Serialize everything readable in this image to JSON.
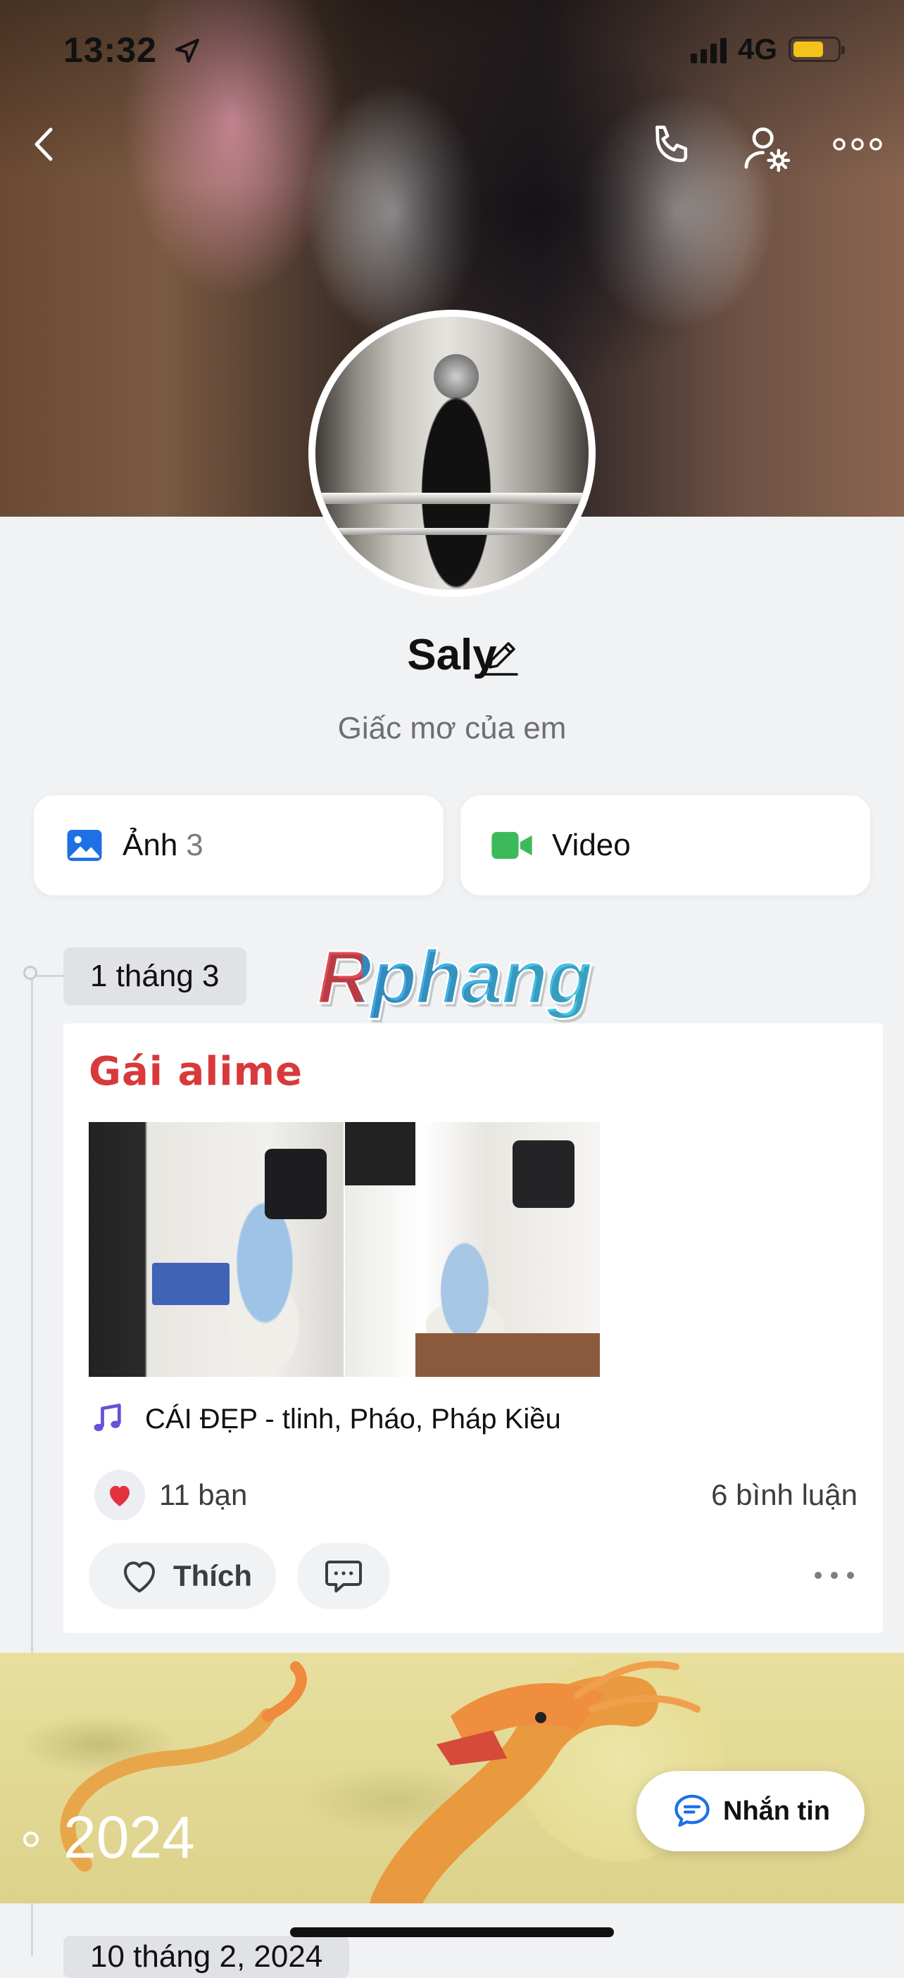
{
  "status_bar": {
    "time": "13:32",
    "network": "4G",
    "colors": {
      "battery": "#f4c21b"
    }
  },
  "header": {
    "icons": [
      "back-icon",
      "phone-icon",
      "profile-settings-icon",
      "more-icon"
    ]
  },
  "profile": {
    "name": "Saly",
    "bio": "Giấc mơ của em"
  },
  "media": {
    "photos_label": "Ảnh",
    "photos_count": "3",
    "video_label": "Video",
    "colors": {
      "photos_icon": "#1f6fe5",
      "video_icon": "#3cba5a"
    }
  },
  "timeline": {
    "date_chip": "1 tháng 3",
    "watermark": "Rphang",
    "post": {
      "title": "Gái alime",
      "music": "CÁI ĐẸP - tlinh, Pháo, Pháp Kiều",
      "reactions": "11 bạn",
      "comments": "6 bình luận",
      "like_label": "Thích",
      "colors": {
        "title": "#d8393b",
        "heart": "#e2313d",
        "music_note": "#6a4fd8"
      }
    },
    "year_banner": "2024",
    "next_chip": "10 tháng 2, 2024"
  },
  "floating": {
    "message_label": "Nhắn tin",
    "colors": {
      "icon": "#1f6fe5"
    }
  }
}
